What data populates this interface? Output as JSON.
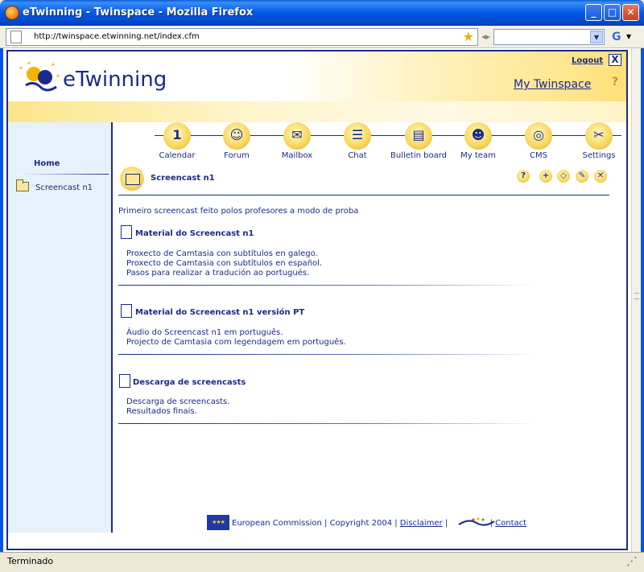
{
  "window": {
    "title": "eTwinning - Twinspace - Mozilla Firefox",
    "minimize": "_",
    "maximize": "□",
    "close": "✕"
  },
  "navbar": {
    "url": "http://twinspace.etwinning.net/index.cfm",
    "search_engine": "G"
  },
  "header": {
    "logo_text": "eTwinning",
    "logout_label": "Logout",
    "close_label": "X",
    "my_twinspace_label": "My Twinspace",
    "help_label": "?"
  },
  "sidebar": {
    "home_label": "Home",
    "items": [
      {
        "label": "Screencast n1"
      }
    ]
  },
  "toolbar": {
    "items": [
      {
        "label": "Calendar",
        "glyph": "1"
      },
      {
        "label": "Forum",
        "glyph": "☺"
      },
      {
        "label": "Mailbox",
        "glyph": "✉"
      },
      {
        "label": "Chat",
        "glyph": "☰"
      },
      {
        "label": "Bulletin board",
        "glyph": "▤"
      },
      {
        "label": "My team",
        "glyph": "☻"
      },
      {
        "label": "CMS",
        "glyph": "◎"
      },
      {
        "label": "Settings",
        "glyph": "✂"
      }
    ]
  },
  "page": {
    "title": "Screencast n1",
    "actions": {
      "help": "?",
      "add": "+",
      "edit": "◇",
      "modify": "✎",
      "delete": "✕"
    },
    "description": "Primeiro screencast feito polos profesores a modo de proba",
    "sections": [
      {
        "title": "Material do Screencast n1",
        "items": [
          "Proxecto de Camtasia con subtítulos en galego.",
          "Proxecto de Camtasia con subtítulos en español.",
          "Pasos para realizar a tradución ao portugués."
        ]
      },
      {
        "title": "Material do Screencast n1 versión PT",
        "items": [
          "Áudio do Screencast n1 em português.",
          "Projecto de Camtasia com legendagem em português."
        ]
      },
      {
        "title": "Descarga de screencasts",
        "items": [
          "Descarga de screencasts.",
          "Resultados finais."
        ]
      }
    ]
  },
  "footer": {
    "eu_flag": "★★★",
    "commission": "European Commission",
    "copyright": "Copyright 2004",
    "disclaimer": "Disclaimer",
    "contact": "Contact"
  },
  "status": {
    "text": "Terminado"
  }
}
